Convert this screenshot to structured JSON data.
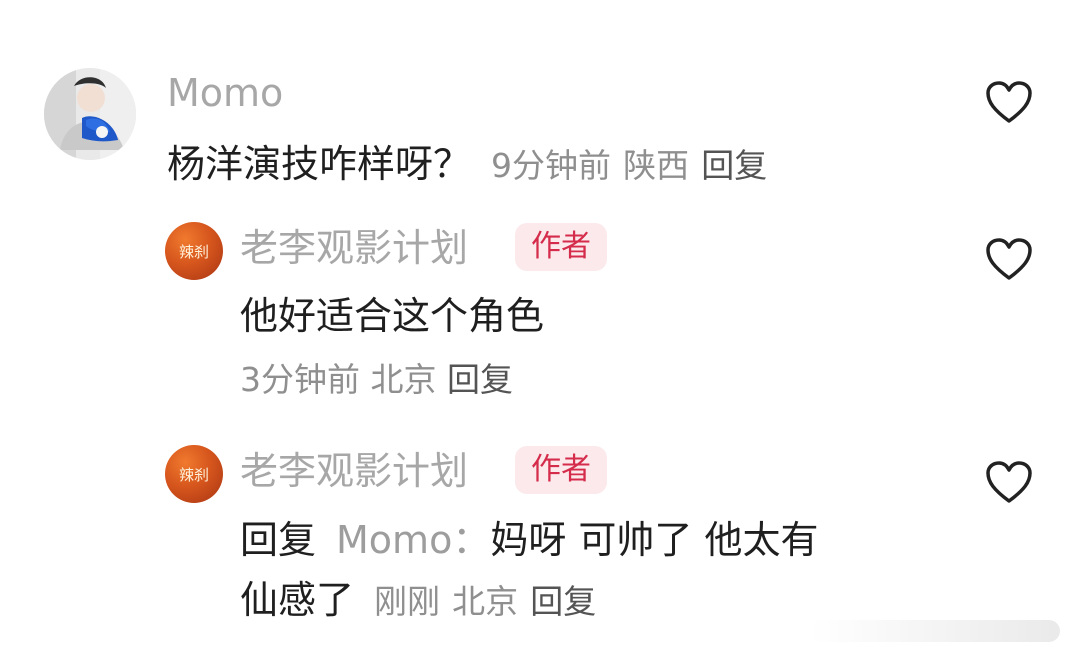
{
  "comments": [
    {
      "username": "Momo",
      "text": "杨洋演技咋样呀？",
      "time": "9分钟前",
      "location": "陕西",
      "reply_label": "回复",
      "heart_icon": "heart-outline-icon"
    }
  ],
  "replies": [
    {
      "username": "老李观影计划",
      "badge": "作者",
      "text": "他好适合这个角色",
      "time": "3分钟前",
      "location": "北京",
      "reply_label": "回复",
      "avatar_text": "辣刹",
      "heart_icon": "heart-outline-icon"
    },
    {
      "username": "老李观影计划",
      "badge": "作者",
      "text_prefix": "回复",
      "mention": "Momo：",
      "text_line_1": "妈呀 可帅了 他太有",
      "text_line_2": "仙感了",
      "time": "刚刚",
      "location": "北京",
      "reply_label": "回复",
      "avatar_text": "辣刹",
      "heart_icon": "heart-outline-icon"
    }
  ],
  "colors": {
    "badge_bg": "#fbe9ec",
    "badge_text": "#d42c4a",
    "username": "#a7a7a7",
    "meta": "#8f8f8f"
  }
}
